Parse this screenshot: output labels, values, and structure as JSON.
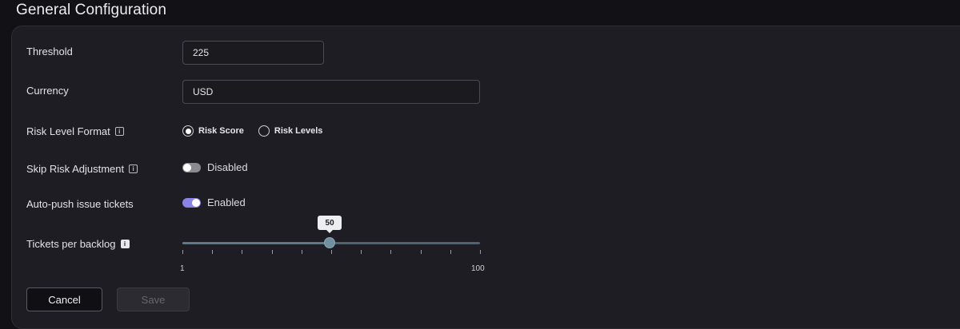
{
  "page": {
    "title": "General Configuration"
  },
  "fields": {
    "threshold": {
      "label": "Threshold",
      "value": "225"
    },
    "currency": {
      "label": "Currency",
      "value": "USD"
    },
    "risk_level_format": {
      "label": "Risk Level Format",
      "options": [
        {
          "label": "Risk Score",
          "selected": true
        },
        {
          "label": "Risk Levels",
          "selected": false
        }
      ]
    },
    "skip_risk_adjustment": {
      "label": "Skip Risk Adjustment",
      "state_label": "Disabled",
      "enabled": false
    },
    "auto_push": {
      "label": "Auto-push issue tickets",
      "state_label": "Enabled",
      "enabled": true
    },
    "tickets_per_backlog": {
      "label": "Tickets per backlog",
      "min": 1,
      "max": 100,
      "value": 50,
      "min_label": "1",
      "max_label": "100",
      "value_label": "50",
      "tick_count": 11
    }
  },
  "actions": {
    "cancel_label": "Cancel",
    "save_label": "Save"
  },
  "icons": {
    "info": "info-icon",
    "info_glyph": "i"
  },
  "colors": {
    "accent_toggle": "#8b82e6",
    "slider": "#5c7a8a",
    "background": "#121216",
    "panel": "#1d1d23"
  }
}
